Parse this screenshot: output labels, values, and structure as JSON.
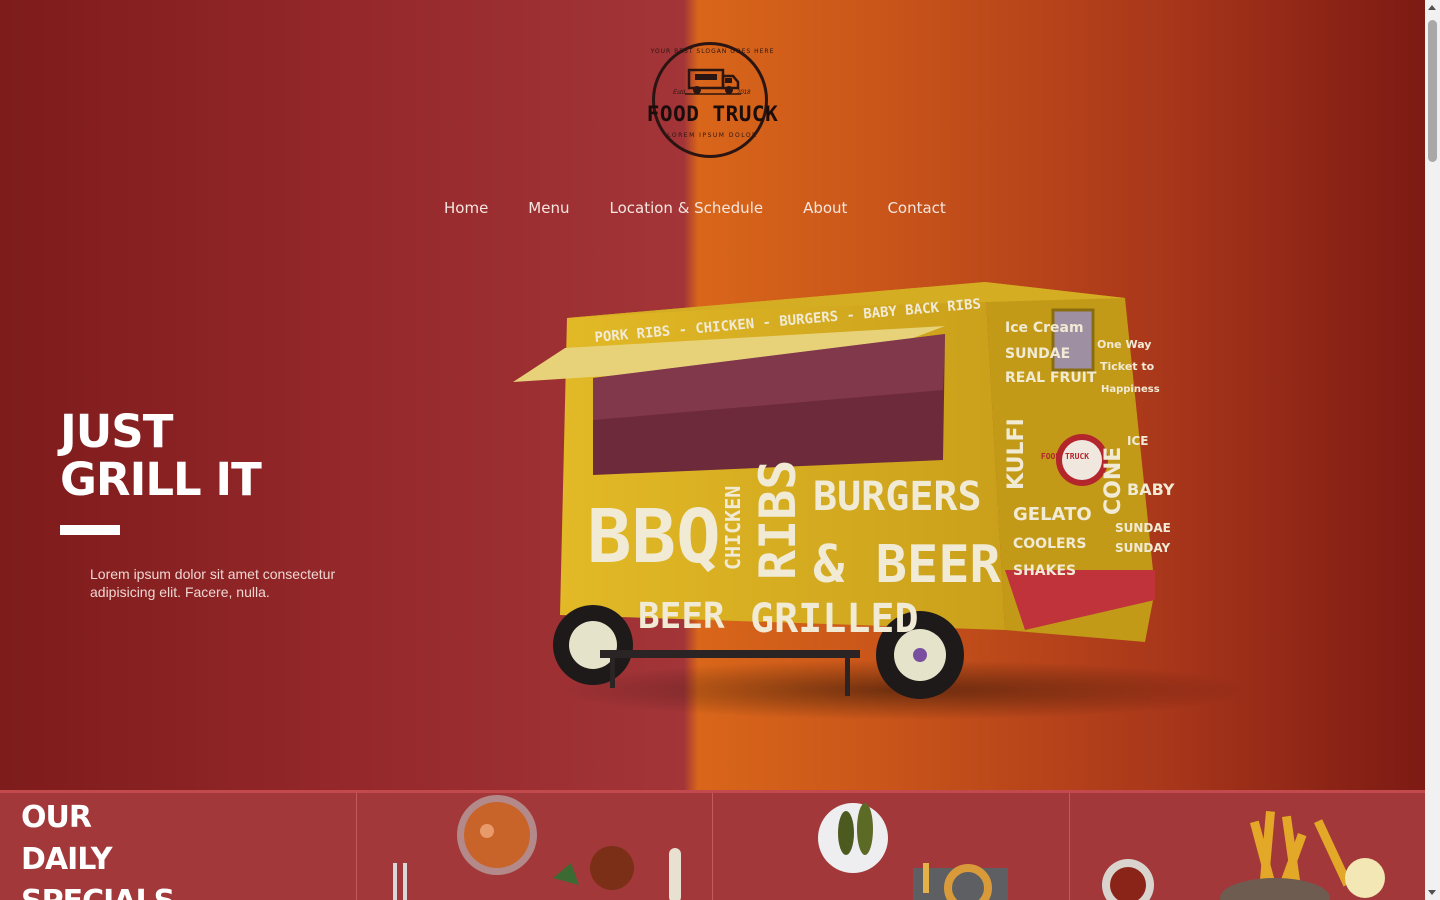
{
  "logo": {
    "ring_text": "YOUR BEST SLOGAN GOES HERE",
    "est_left": "Estd",
    "est_right": "2018",
    "title": "FOOD TRUCK",
    "subtitle": "LOREM IPSUM DOLOR"
  },
  "nav": {
    "items": [
      "Home",
      "Menu",
      "Location & Schedule",
      "About",
      "Contact"
    ]
  },
  "hero": {
    "headline_line1": "JUST",
    "headline_line2": "GRILL IT",
    "lead": "Lorem ipsum dolor sit amet consectetur adipisicing elit. Facere, nulla."
  },
  "truck_signage": {
    "top_banner": "PORK RIBS  -  CHICKEN  -  BURGERS  -  BABY BACK RIBS",
    "bbq": "BBQ",
    "chicken": "CHICKEN",
    "ribs": "RIBS",
    "burgers": "BURGERS",
    "and_beer": "& BEER",
    "beer": "BEER",
    "grilled": "GRILLED",
    "side_left": [
      "Ice Cream",
      "SUNDAE",
      "REAL FRUIT",
      "KULFI",
      "GELATO",
      "COOLERS",
      "SHAKES"
    ],
    "side_right": [
      "One Way",
      "Ticket to",
      "Happiness",
      "CONE",
      "ICE",
      "BABY",
      "SUNDAE",
      "SUNDAY"
    ],
    "badge": "FOOD TRUCK"
  },
  "specials": {
    "title_line1": "OUR",
    "title_line2": "DAILY",
    "title_line3": "SPECIALS"
  },
  "colors": {
    "hero_red": "#a33538",
    "hero_orange": "#d9661a",
    "truck_yellow": "#d9b21f",
    "specials_bg": "#a3383a"
  }
}
